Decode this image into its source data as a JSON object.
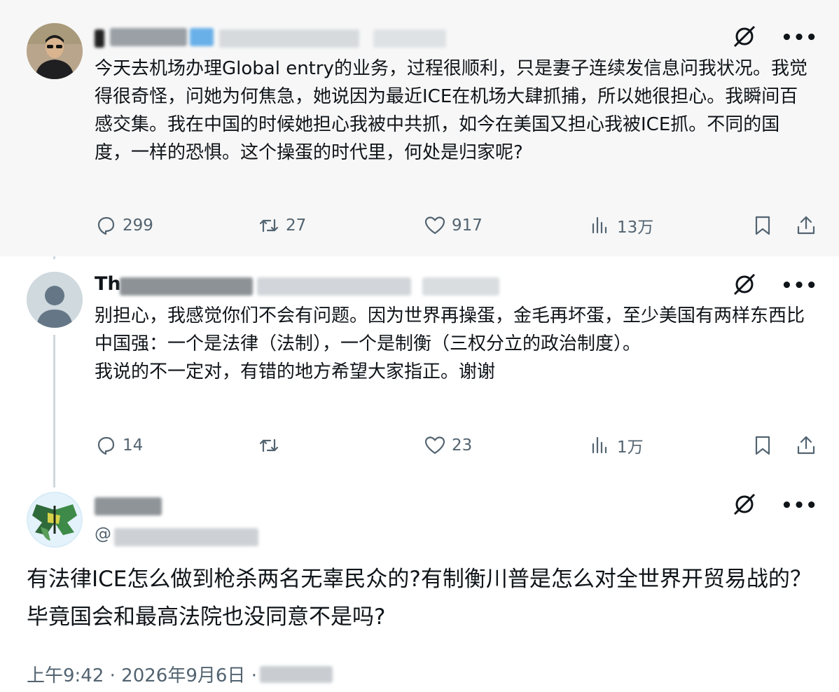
{
  "tweets": [
    {
      "text": "今天去机场办理Global entry的业务，过程很顺利，只是妻子连续发信息问我状况。我觉得很奇怪，问她为何焦急，她说因为最近ICE在机场大肆抓捕，所以她很担心。我瞬间百感交集。我在中国的时候她担心我被中共抓，如今在美国又担心我被ICE抓。不同的国度，一样的恐惧。这个操蛋的时代里，何处是归家呢?",
      "replies": "299",
      "reposts": "27",
      "likes": "917",
      "views": "13万"
    },
    {
      "name_visible": "Th",
      "text": "别担心，我感觉你们不会有问题。因为世界再操蛋，金毛再坏蛋，至少美国有两样东西比中国强：一个是法律（法制），一个是制衡（三权分立的政治制度）。\n我说的不一定对，有错的地方希望大家指正。谢谢",
      "replies": "14",
      "reposts": "",
      "likes": "23",
      "views": "1万"
    },
    {
      "handle_visible": "@",
      "text": "有法律ICE怎么做到枪杀两名无辜民众的?有制衡川普是怎么对全世界开贸易战的？毕竟国会和最高法院也没同意不是吗?",
      "timestamp": "上午9:42 · 2026年9月6日 · "
    }
  ],
  "icons": {
    "reply": "reply-icon",
    "repost": "repost-icon",
    "like": "heart-icon",
    "views": "views-icon",
    "bookmark": "bookmark-icon",
    "share": "share-icon",
    "grok": "grok-icon",
    "more": "more-icon"
  },
  "colors": {
    "text": "#0f1419",
    "muted": "#536471",
    "thread_line": "#cfd9de",
    "highlight_bg": "#f7f7f7"
  }
}
